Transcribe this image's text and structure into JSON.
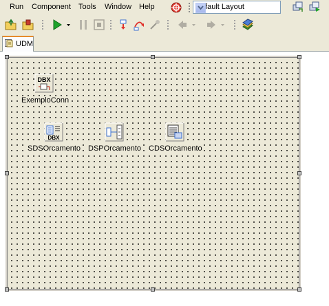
{
  "menu": {
    "items": [
      "Run",
      "Component",
      "Tools",
      "Window",
      "Help"
    ],
    "layout_select": {
      "value": "Default Layout"
    }
  },
  "toolbar": {
    "icons": [
      "open-project-icon",
      "save-icon",
      "run-icon",
      "pause-icon",
      "stop-icon",
      "trace-into-icon",
      "step-over-icon",
      "run-to-cursor-icon",
      "back-icon",
      "forward-icon",
      "help-book-icon"
    ]
  },
  "tabs": [
    {
      "label": "UDM",
      "active": true
    }
  ],
  "designer": {
    "components": [
      {
        "name": "ExemploConn",
        "icon": "dbx-connection-icon"
      },
      {
        "name": "SDSOrcamento",
        "icon": "sql-dataset-icon"
      },
      {
        "name": "DSPOrcamento",
        "icon": "dataset-provider-icon"
      },
      {
        "name": "CDSOrcamento",
        "icon": "client-dataset-icon"
      }
    ]
  },
  "colors": {
    "toolbar_bg": "#ece9d8",
    "grid_dot": "#000000",
    "tab_accent": "#e68b2c",
    "run_green": "#1fa32b"
  }
}
